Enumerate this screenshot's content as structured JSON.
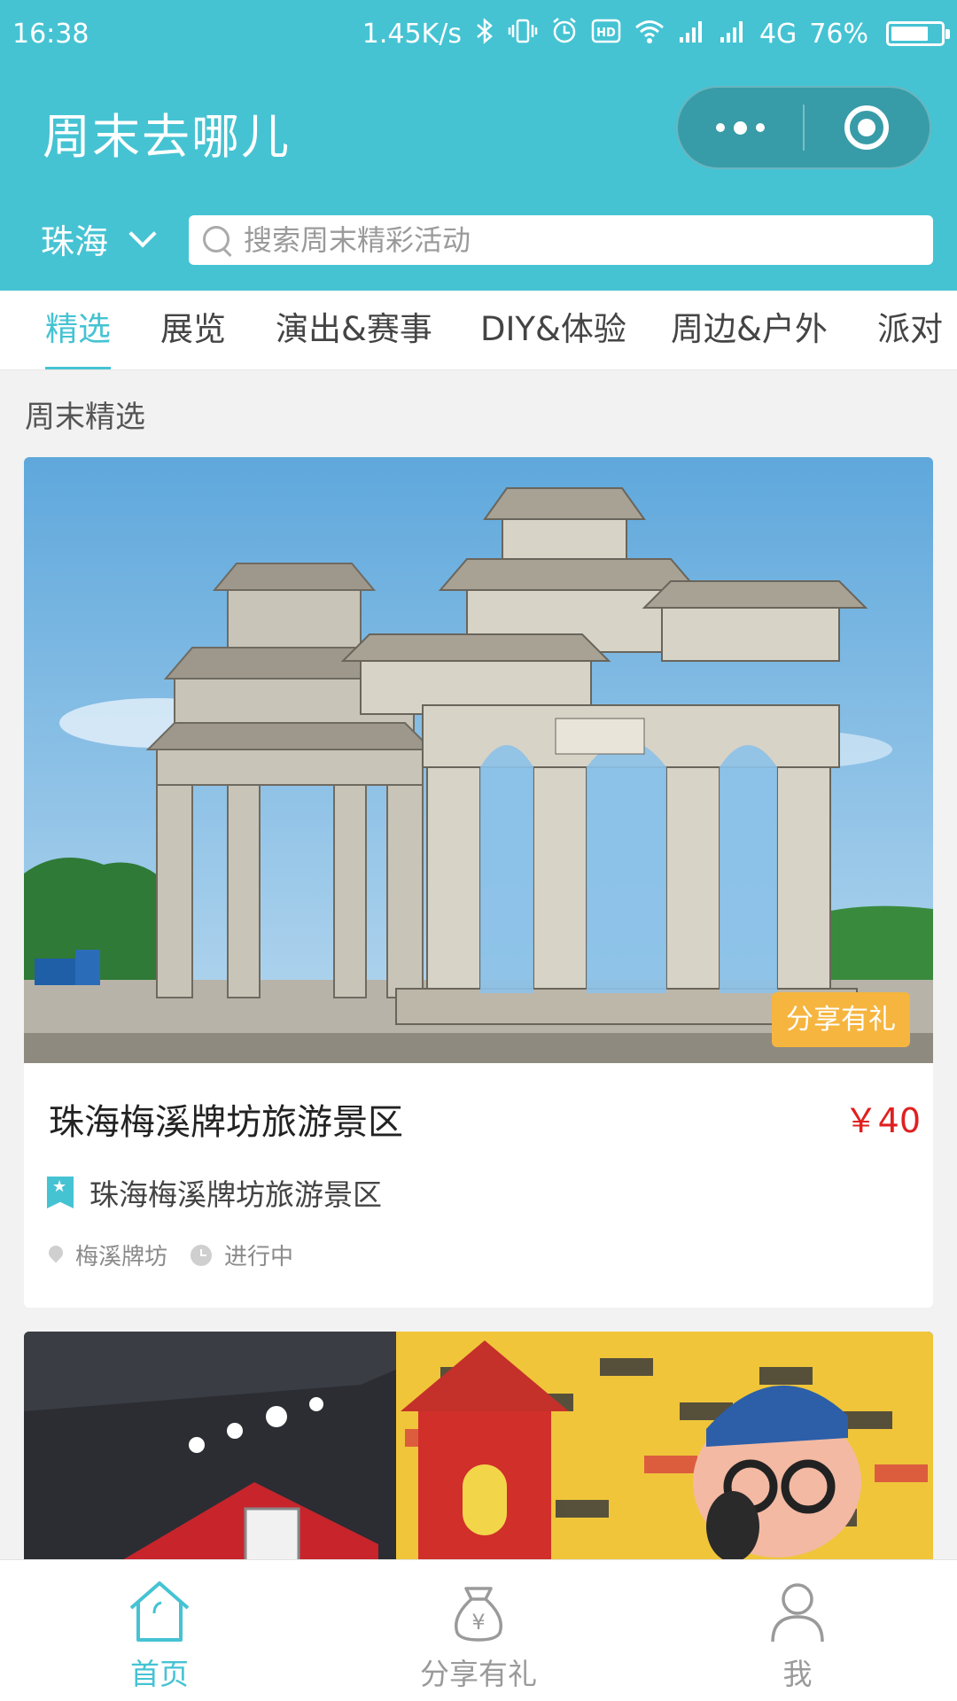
{
  "status_bar": {
    "time": "16:38",
    "network_speed": "1.45K/s",
    "network_type": "4G",
    "battery": "76%",
    "battery_level": 0.76
  },
  "header": {
    "title": "周末去哪儿",
    "city": "珠海",
    "search_placeholder": "搜索周末精彩活动"
  },
  "tabs": [
    {
      "label": "精选",
      "active": true
    },
    {
      "label": "展览",
      "active": false
    },
    {
      "label": "演出&赛事",
      "active": false
    },
    {
      "label": "DIY&体验",
      "active": false
    },
    {
      "label": "周边&户外",
      "active": false
    },
    {
      "label": "派对",
      "active": false
    }
  ],
  "section_title": "周末精选",
  "cards": [
    {
      "badge": "分享有礼",
      "title": "珠海梅溪牌坊旅游景区",
      "price": "￥40",
      "venue": "珠海梅溪牌坊旅游景区",
      "location": "梅溪牌坊",
      "status": "进行中"
    }
  ],
  "bottom_nav": [
    {
      "label": "首页",
      "icon": "home-icon",
      "active": true
    },
    {
      "label": "分享有礼",
      "icon": "money-bag-icon",
      "active": false
    },
    {
      "label": "我",
      "icon": "person-icon",
      "active": false
    }
  ],
  "colors": {
    "accent": "#45c3d3",
    "price": "#e02020",
    "badge": "#f5b53f"
  }
}
